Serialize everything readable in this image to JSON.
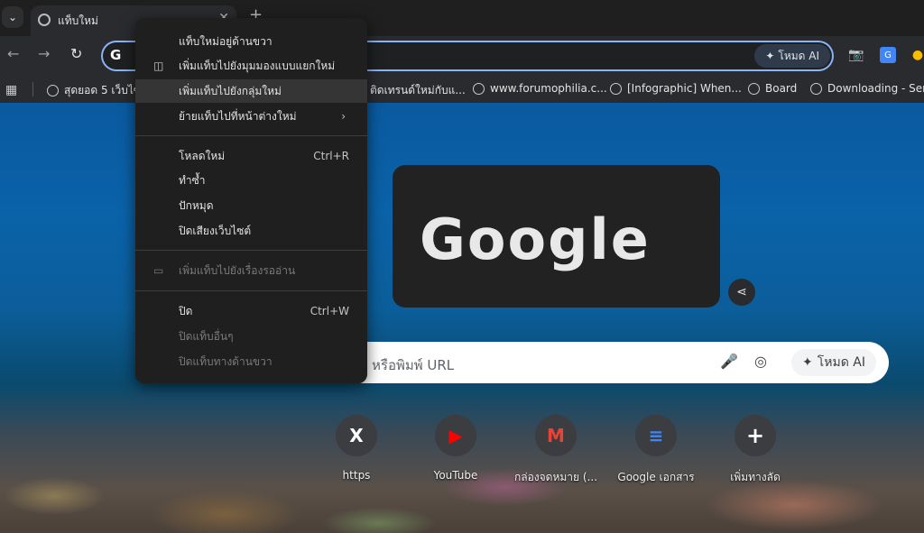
{
  "tab": {
    "title": "แท็บใหม่",
    "close_icon": "✕",
    "new_tab_icon": "+"
  },
  "toolbar": {
    "back_icon": "←",
    "forward_icon": "→",
    "reload_icon": "↻",
    "omnibox_g": "G",
    "ai_mode_label": "โหมด AI"
  },
  "bookmarks": {
    "apps_icon": "▦",
    "items": [
      {
        "label": "สุดยอด 5 เว็บไซต์..."
      },
      {
        "label": "ติดเทรนด์ใหม่กับแ..."
      },
      {
        "label": "www.forumophilia.c..."
      },
      {
        "label": "[Infographic] When..."
      },
      {
        "label": "Board"
      },
      {
        "label": "Downloading - Sen..."
      }
    ]
  },
  "context_menu": {
    "items": [
      {
        "label": "แท็บใหม่อยู่ด้านขวา"
      },
      {
        "label": "เพิ่มแท็บไปยังมุมมองแบบแยกใหม่"
      },
      {
        "label": "เพิ่มแท็บไปยังกลุ่มใหม่"
      },
      {
        "label": "ย้ายแท็บไปที่หน้าต่างใหม่"
      },
      {
        "label": "โหลดใหม่",
        "shortcut": "Ctrl+R"
      },
      {
        "label": "ทำซ้ำ"
      },
      {
        "label": "ปักหมุด"
      },
      {
        "label": "ปิดเสียงเว็บไซต์"
      },
      {
        "label": "เพิ่มแท็บไปยังเรื่องรออ่าน"
      },
      {
        "label": "ปิด",
        "shortcut": "Ctrl+W"
      },
      {
        "label": "ปิดแท็บอื่นๆ"
      },
      {
        "label": "ปิดแท็บทางด้านขวา"
      }
    ]
  },
  "doodle": {
    "text": "Google"
  },
  "search": {
    "placeholder": "e หรือพิมพ์ URL",
    "ai_mode_label": "โหมด AI"
  },
  "shortcuts": [
    {
      "label": "https",
      "icon": "X"
    },
    {
      "label": "YouTube",
      "icon": "▶"
    },
    {
      "label": "กล่องจดหมาย (...",
      "icon": "M"
    },
    {
      "label": "Google เอกสาร",
      "icon": "≡"
    },
    {
      "label": "เพิ่มทางลัด",
      "icon": "+"
    }
  ]
}
